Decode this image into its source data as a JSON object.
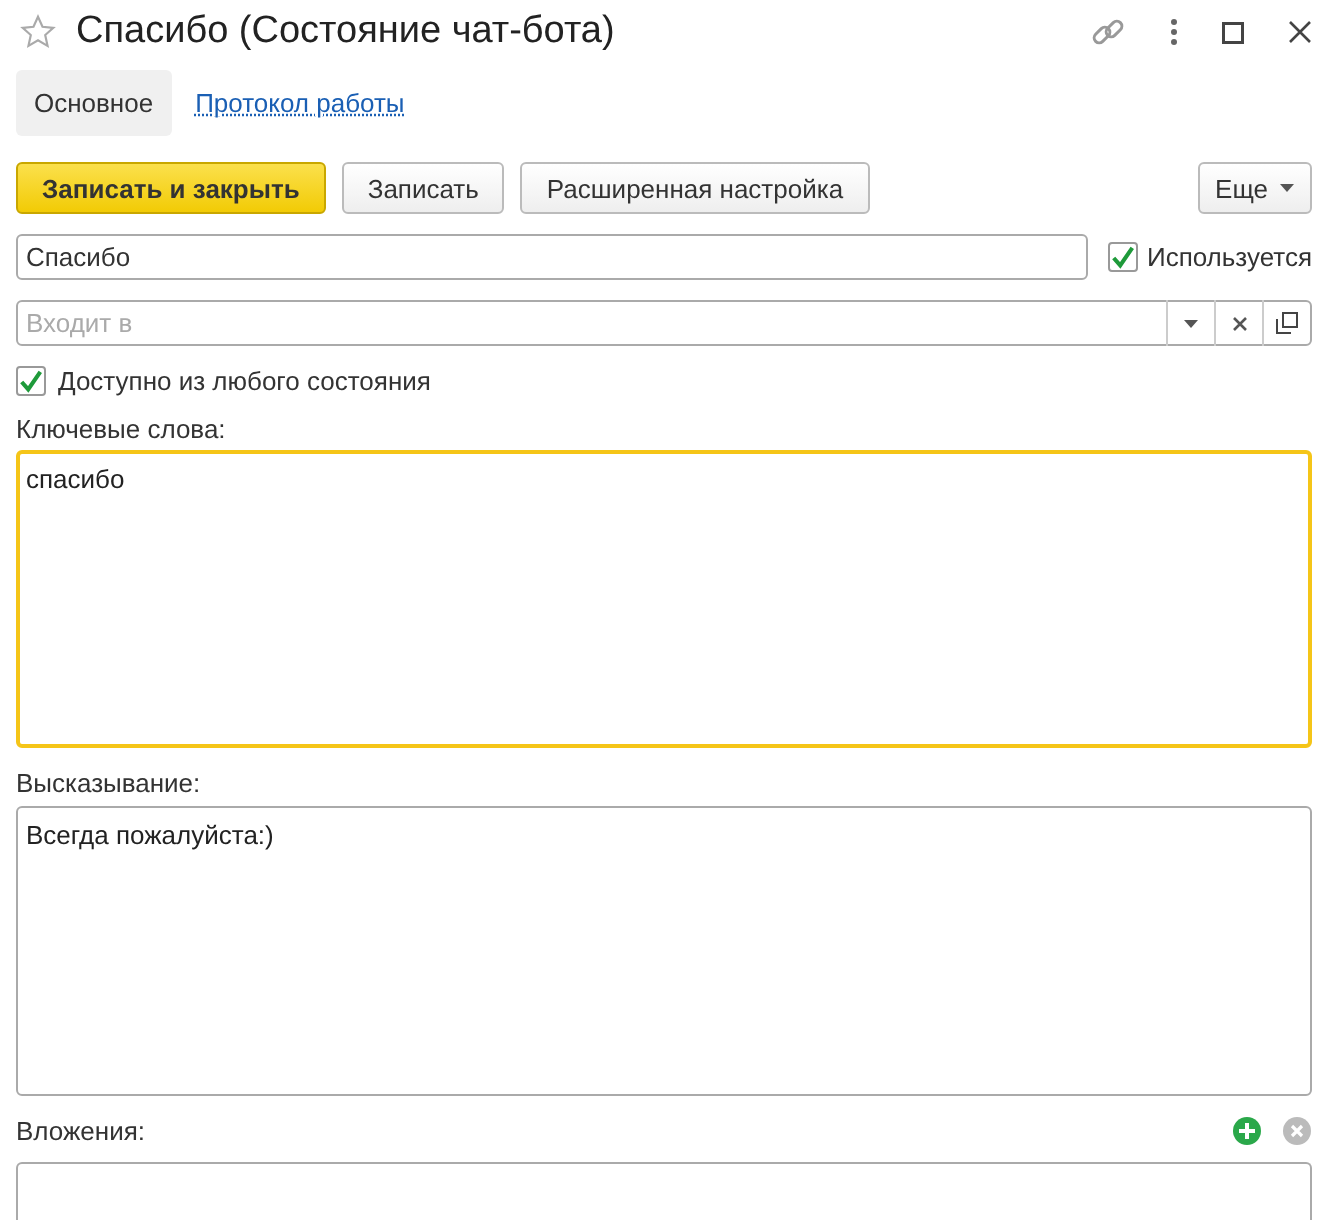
{
  "window": {
    "title": "Спасибо (Состояние чат-бота)",
    "favorite": false
  },
  "tabs": [
    {
      "label": "Основное",
      "selected": true
    },
    {
      "label": "Протокол работы",
      "selected": false
    }
  ],
  "toolbar": {
    "buttons": [
      {
        "label": "Записать и закрыть",
        "kind": "primary"
      },
      {
        "label": "Записать",
        "kind": "normal"
      },
      {
        "label": "Расширенная настройка",
        "kind": "normal"
      }
    ],
    "more": "Еще"
  },
  "name_field": {
    "value": "Спасибо"
  },
  "used_checkbox": {
    "label": "Используется",
    "checked": true
  },
  "parent_field": {
    "placeholder": "Входит в"
  },
  "any_state_checkbox": {
    "label": "Доступно из любого состояния",
    "checked": true
  },
  "keywords": {
    "label": "Ключевые слова:",
    "value": "спасибо",
    "focused": true
  },
  "utterance": {
    "label": "Высказывание:",
    "value": "Всегда пожалуйста:)",
    "focused": false
  },
  "attachments": {
    "label": "Вложения:"
  }
}
